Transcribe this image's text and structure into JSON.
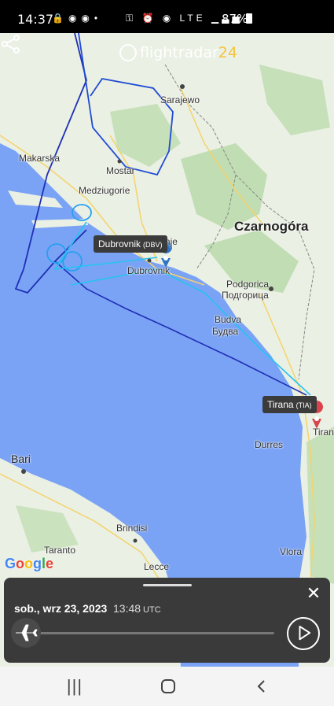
{
  "status_bar": {
    "time": "14:37",
    "left_icons": [
      "lock-icon",
      "location-icon",
      "location-icon",
      "dot-icon"
    ],
    "right_icons": [
      "key-icon",
      "alarm-icon",
      "location-icon",
      "lte-icon",
      "signal-icon",
      "signal-icon"
    ],
    "network": "LTE",
    "battery": "87%"
  },
  "app": {
    "logo_main": "flightradar",
    "logo_accent": "24",
    "share_icon": "share-icon"
  },
  "map": {
    "places": {
      "sarajewo": "Sarajewo",
      "makarska": "Makarska",
      "mostar": "Mostar",
      "medziugorie": "Medziugorie",
      "trebinje": "Trebinje",
      "dubrovnik": "Dubrovnik",
      "czarnogora": "Czarnogóra",
      "podgorica": "Podgorica",
      "podgorica_cyr": "Подгорица",
      "budva": "Budva",
      "budva_cyr": "Будва",
      "durres": "Durres",
      "tirana_city": "Tiran",
      "bari": "Bari",
      "brindisi": "Brindisi",
      "taranto": "Taranto",
      "lecce": "Lecce",
      "vlora": "Vlora"
    },
    "departure": {
      "name": "Dubrovnik",
      "code": "(DBV)"
    },
    "arrival": {
      "name": "Tirana",
      "code": "(TIA)"
    },
    "attribution": "Google",
    "colors": {
      "sea": "#7aa3f5",
      "land": "#eaf0e4",
      "forest": "#b6d8a6",
      "track_dark": "#1f2fb5",
      "track_light": "#27c3f0",
      "departure_pin": "#2d74c4",
      "arrival_pin": "#d9434b"
    }
  },
  "playback": {
    "date": "sob., wrz 23, 2023",
    "time": "13:48",
    "timezone": "UTC",
    "progress": 0.0,
    "close_icon": "close-icon",
    "plane_icon": "plane-icon",
    "play_icon": "play-icon"
  },
  "nav": {
    "recents": "|||",
    "home": "home-icon",
    "back": "back-icon"
  }
}
